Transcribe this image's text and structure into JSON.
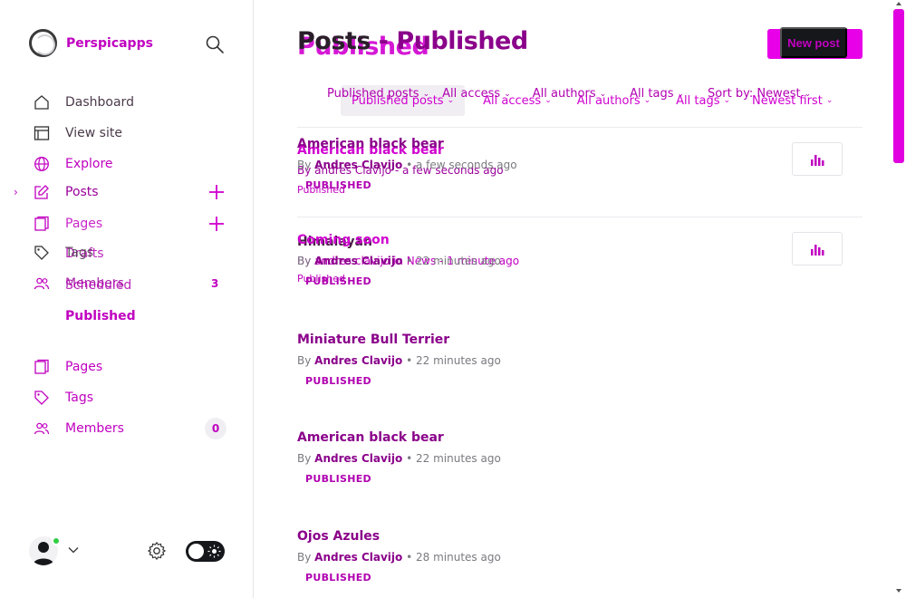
{
  "brand": {
    "name": "Perspicapps",
    "ghost_name": "Perspicapps"
  },
  "nav_top": [
    {
      "label": "Dashboard",
      "ghost": "Dashboard"
    },
    {
      "label": "View site",
      "ghost": "View site"
    },
    {
      "label": "Explore"
    },
    {
      "label": "Posts"
    },
    {
      "label": "Pages",
      "ghost": "Pages"
    }
  ],
  "nav_ghost": {
    "drafts": "Drafts",
    "tags": "Tags",
    "members": "Members",
    "scheduled": "Scheduled",
    "members_count": "3"
  },
  "nav_sub": {
    "published": "Published"
  },
  "nav_bottom": [
    {
      "label": "Pages"
    },
    {
      "label": "Tags"
    },
    {
      "label": "Members",
      "count": "0"
    }
  ],
  "header": {
    "title_prefix": "Posts",
    "title_sep": " - ",
    "title_suffix": "Published",
    "ghost_title": "Published",
    "new_post": "New post",
    "ghost_new_post": "New post"
  },
  "filters_a": [
    {
      "label": "Published posts"
    },
    {
      "label": "All access"
    },
    {
      "label": "All authors"
    },
    {
      "label": "All tags"
    },
    {
      "label": "Sort by: Newest"
    }
  ],
  "filters_b": [
    {
      "label": "Published posts"
    },
    {
      "label": "All access"
    },
    {
      "label": "All authors"
    },
    {
      "label": "All tags"
    },
    {
      "label": "Newest first"
    }
  ],
  "ghost_posts": {
    "p1_title": "American black bear",
    "p1_meta": "By andres Clavijo - a few seconds ago",
    "p1_status": "Published",
    "p2_title": "Himalayan",
    "p2_meta": "By andres clavijo in News - 1 minute ago",
    "p2_meta_b": "By Andres Clavijo • 22 minutes ago",
    "p2_status": "Published",
    "p2_alt_title": "Coming soon"
  },
  "posts": [
    {
      "title": "American black bear",
      "by": "By",
      "author": "Andres Clavijo",
      "time": "a few seconds ago",
      "status": "PUBLISHED"
    },
    {
      "title": "Coming soon",
      "by": "By",
      "author": "Andres Clavijo",
      "time": "22 minutes ago",
      "status": "PUBLISHED"
    },
    {
      "title": "Miniature Bull Terrier",
      "by": "By",
      "author": "Andres Clavijo",
      "time": "22 minutes ago",
      "status": "PUBLISHED"
    },
    {
      "title": "American black bear",
      "by": "By",
      "author": "Andres Clavijo",
      "time": "22 minutes ago",
      "status": "PUBLISHED"
    },
    {
      "title": "Ojos Azules",
      "by": "By",
      "author": "Andres Clavijo",
      "time": "28 minutes ago",
      "status": "PUBLISHED"
    }
  ],
  "colors": {
    "accent": "#c000c0",
    "accent_dark": "#8a008a",
    "online": "#30cf43"
  },
  "icons": [
    "search-icon",
    "home-icon",
    "browser-icon",
    "globe-icon",
    "edit-icon",
    "page-icon",
    "tag-icon",
    "members-icon",
    "plus-icon",
    "chevron-down-icon",
    "gear-icon",
    "sun-icon",
    "stats-icon"
  ]
}
